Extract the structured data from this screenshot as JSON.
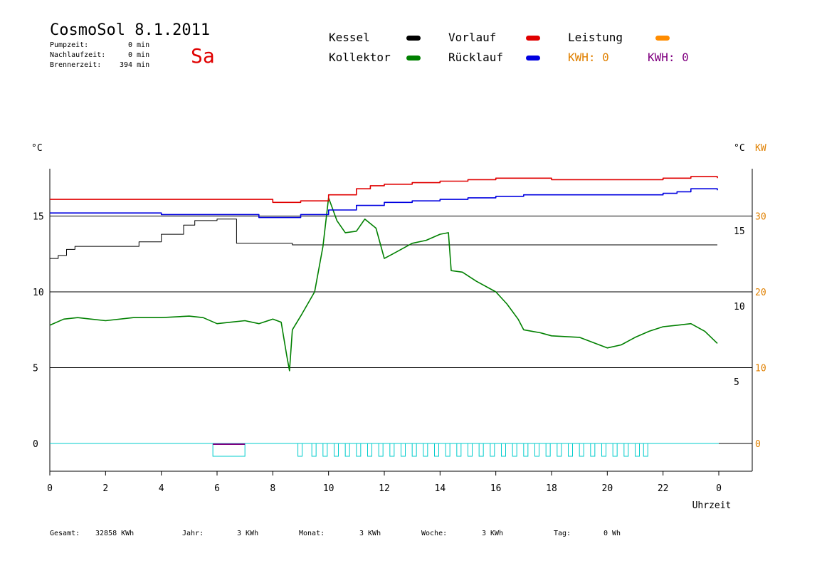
{
  "header": {
    "title": "CosmoSol 8.1.2011",
    "weekday": "Sa",
    "stats": [
      {
        "label": "Pumpzeit:",
        "value": "0 min"
      },
      {
        "label": "Nachlaufzeit:",
        "value": "0 min"
      },
      {
        "label": "Brennerzeit:",
        "value": "394 min"
      }
    ]
  },
  "legend": {
    "kessel": "Kessel",
    "kollektor": "Kollektor",
    "vorlauf": "Vorlauf",
    "ruecklauf": "Rücklauf",
    "leistung": "Leistung",
    "kwh1": "KWH: 0",
    "kwh2": "KWH: 0"
  },
  "footer": {
    "gesamt_label": "Gesamt:",
    "gesamt_value": "32858 KWh",
    "jahr_label": "Jahr:",
    "jahr_value": "3 KWh",
    "monat_label": "Monat:",
    "monat_value": "3 KWh",
    "woche_label": "Woche:",
    "woche_value": "3 KWh",
    "tag_label": "Tag:",
    "tag_value": "0 Wh"
  },
  "chart_data": {
    "type": "line",
    "xlabel": "Uhrzeit",
    "ylabel_left": "°C",
    "ylabel_right_1": "°C",
    "ylabel_right_2": "KW",
    "x_ticks": [
      "0",
      "2",
      "4",
      "6",
      "8",
      "10",
      "12",
      "14",
      "16",
      "18",
      "20",
      "22",
      "0"
    ],
    "y_left_ticks": [
      "0",
      "5",
      "10",
      "15"
    ],
    "y_right_ticks_c": [
      "5",
      "10",
      "15"
    ],
    "y_right_ticks_kw": [
      "0",
      "10",
      "20",
      "30"
    ],
    "xlim": [
      0,
      24
    ],
    "ylim_left": [
      -2,
      18
    ],
    "colors": {
      "kessel": "#000000",
      "kollektor": "#008000",
      "vorlauf": "#e00000",
      "ruecklauf": "#0000e0",
      "leistung": "#ff8c00",
      "pump": "#00cccc",
      "burner": "#800080",
      "kw_axis": "#e08000",
      "kwh2": "#800080"
    },
    "series": [
      {
        "name": "Kessel",
        "x": [
          0,
          0.3,
          0.6,
          0.9,
          2.0,
          2.8,
          3.2,
          4.0,
          4.8,
          5.2,
          6.0,
          6.6,
          6.7,
          8.0,
          8.7,
          10.0,
          12.0,
          14.0,
          16.0,
          18.0,
          20.0,
          22.0,
          23.95
        ],
        "values": [
          12.2,
          12.4,
          12.8,
          13.0,
          13.0,
          13.0,
          13.3,
          13.8,
          14.4,
          14.7,
          14.8,
          14.8,
          13.2,
          13.2,
          13.1,
          13.1,
          13.1,
          13.1,
          13.1,
          13.1,
          13.1,
          13.1,
          13.1
        ]
      },
      {
        "name": "Kollektor",
        "x": [
          0,
          0.5,
          1,
          2,
          3,
          4,
          5,
          5.5,
          6,
          6.5,
          7,
          7.5,
          8,
          8.3,
          8.5,
          8.6,
          8.7,
          9.0,
          9.5,
          9.8,
          10.0,
          10.3,
          10.6,
          11.0,
          11.3,
          11.7,
          12.0,
          12.3,
          13.0,
          13.5,
          14.0,
          14.3,
          14.4,
          14.8,
          15.3,
          16.0,
          16.4,
          16.8,
          17.0,
          17.3,
          17.6,
          18.0,
          19.0,
          20.0,
          20.5,
          21.0,
          21.5,
          22.0,
          22.5,
          23.0,
          23.5,
          23.95
        ],
        "values": [
          7.8,
          8.2,
          8.3,
          8.1,
          8.3,
          8.3,
          8.4,
          8.3,
          7.9,
          8.0,
          8.1,
          7.9,
          8.2,
          8.0,
          5.8,
          4.8,
          7.5,
          8.4,
          10.0,
          13.0,
          16.2,
          14.7,
          13.9,
          14.0,
          14.8,
          14.2,
          12.2,
          12.5,
          13.2,
          13.4,
          13.8,
          13.9,
          11.4,
          11.3,
          10.7,
          10.0,
          9.2,
          8.2,
          7.5,
          7.4,
          7.3,
          7.1,
          7.0,
          6.3,
          6.5,
          7.0,
          7.4,
          7.7,
          7.8,
          7.9,
          7.4,
          6.6
        ]
      },
      {
        "name": "Vorlauf",
        "x": [
          0,
          2,
          4,
          6,
          7.8,
          8.0,
          9.0,
          10.0,
          11.0,
          11.5,
          12.0,
          13.0,
          14.0,
          15.0,
          16.0,
          17.0,
          18.0,
          19.0,
          20.0,
          21.0,
          22.0,
          23.0,
          23.95
        ],
        "values": [
          16.1,
          16.1,
          16.1,
          16.1,
          16.1,
          15.9,
          16.0,
          16.4,
          16.8,
          17.0,
          17.1,
          17.2,
          17.3,
          17.4,
          17.5,
          17.5,
          17.4,
          17.4,
          17.4,
          17.4,
          17.5,
          17.6,
          17.5
        ]
      },
      {
        "name": "Rücklauf",
        "x": [
          0,
          2,
          4,
          5.5,
          6,
          7.5,
          8.5,
          9.0,
          10.0,
          11.0,
          12.0,
          13.0,
          14.0,
          15.0,
          16.0,
          17.0,
          18.0,
          19.0,
          20.0,
          21.0,
          22.0,
          22.5,
          23.0,
          23.95
        ],
        "values": [
          15.2,
          15.2,
          15.1,
          15.1,
          15.1,
          14.9,
          14.9,
          15.1,
          15.4,
          15.7,
          15.9,
          16.0,
          16.1,
          16.2,
          16.3,
          16.4,
          16.4,
          16.4,
          16.4,
          16.4,
          16.5,
          16.6,
          16.8,
          16.7
        ]
      },
      {
        "name": "Leistung",
        "x": [
          0,
          24
        ],
        "values": [
          0,
          0
        ]
      }
    ],
    "pump_pulses": [
      8.9,
      9.4,
      9.8,
      10.2,
      10.6,
      11.0,
      11.4,
      11.8,
      12.2,
      12.6,
      13.0,
      13.4,
      13.8,
      14.2,
      14.6,
      15.0,
      15.4,
      15.8,
      16.2,
      16.6,
      17.0,
      17.4,
      17.8,
      18.2,
      18.6,
      19.0,
      19.4,
      19.8,
      20.2,
      20.6,
      21.0,
      21.3
    ]
  }
}
